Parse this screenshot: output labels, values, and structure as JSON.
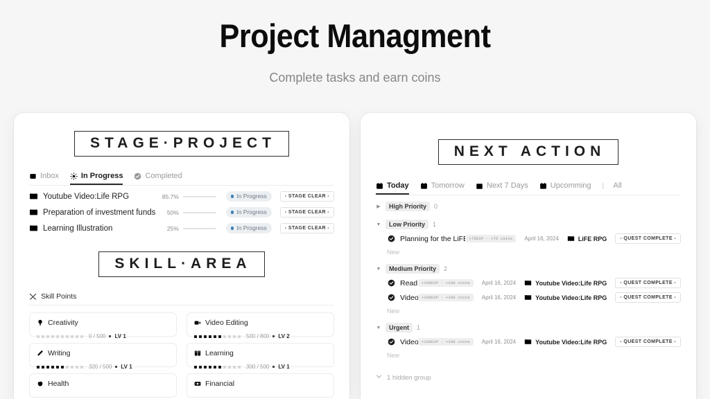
{
  "hero": {
    "title": "Project Managment",
    "subtitle": "Complete tasks and earn coins"
  },
  "colors": {
    "page_background": "#f6f6f6",
    "panel_background": "#ffffff",
    "text_primary": "#121212",
    "text_muted": "#9a9a9a",
    "status_dot_blue": "#3c7fbd",
    "chip_background": "#ededed"
  },
  "left_panel": {
    "heading": "STAGE·PROJECT",
    "tabs": [
      {
        "label": "Inbox",
        "icon": "inbox-icon",
        "active": false
      },
      {
        "label": "In Progress",
        "icon": "sun-icon",
        "active": true
      },
      {
        "label": "Completed",
        "icon": "check-circle-icon",
        "active": false
      }
    ],
    "projects": [
      {
        "icon": "folder-icon",
        "name": "Youtube Video:Life RPG",
        "percent_label": "85.7%",
        "percent_value": 85.7,
        "status": "In Progress",
        "action_label": "- STAGE CLEAR -"
      },
      {
        "icon": "folder-icon",
        "name": "Preparation of investment funds",
        "percent_label": "50%",
        "percent_value": 50,
        "status": "In Progress",
        "action_label": "- STAGE CLEAR -"
      },
      {
        "icon": "folder-icon",
        "name": "Learning Illustration",
        "percent_label": "25%",
        "percent_value": 25,
        "status": "In Progress",
        "action_label": "- STAGE CLEAR -"
      }
    ],
    "skill_heading": "SKILL·AREA",
    "skill_points_label": "Skill Points",
    "skill_points_icon": "crossed-swords-icon",
    "skills": [
      {
        "name": "Creativity",
        "icon": "lightbulb-icon",
        "pips_total": 10,
        "pips_filled": 0,
        "values": "0 / 500",
        "level": "LV 1"
      },
      {
        "name": "Video Editing",
        "icon": "video-icon",
        "pips_total": 10,
        "pips_filled": 6,
        "values": "500 / 800",
        "level": "LV 2"
      },
      {
        "name": "Writing",
        "icon": "pencil-icon",
        "pips_total": 10,
        "pips_filled": 6,
        "values": "320 / 500",
        "level": "LV 1"
      },
      {
        "name": "Learning",
        "icon": "book-icon",
        "pips_total": 10,
        "pips_filled": 6,
        "values": "300 / 500",
        "level": "LV 1"
      },
      {
        "name": "Health",
        "icon": "apple-icon",
        "pips_total": 10,
        "pips_filled": 0,
        "values": "",
        "level": ""
      },
      {
        "name": "Financial",
        "icon": "money-icon",
        "pips_total": 10,
        "pips_filled": 0,
        "values": "",
        "level": ""
      }
    ]
  },
  "right_panel": {
    "heading": "NEXT ACTION",
    "tabs": [
      {
        "label": "Today",
        "icon": "calendar-icon",
        "active": true
      },
      {
        "label": "Tomorrow",
        "icon": "calendar-icon",
        "active": false
      },
      {
        "label": "Next 7 Days",
        "icon": "calendar-grid-icon",
        "active": false
      },
      {
        "label": "Upcomming",
        "icon": "calendar-icon",
        "active": false
      },
      {
        "label": "All",
        "icon": "list-icon",
        "active": false
      }
    ],
    "groups": [
      {
        "label": "High Priority",
        "count": "0",
        "expanded": false,
        "tasks": [],
        "new_label": ""
      },
      {
        "label": "Low Priority",
        "count": "1",
        "expanded": true,
        "new_label": "New",
        "tasks": [
          {
            "name": "Planning for the LiFE RPG launch",
            "reward": "+75EXP · +75 coins",
            "date": "April 16, 2024",
            "project": "LiFE RPG",
            "action_label": "- QUEST COMPLETE -"
          }
        ]
      },
      {
        "label": "Medium Priority",
        "count": "2",
        "expanded": true,
        "new_label": "New",
        "tasks": [
          {
            "name": "Read Actionable Gamification",
            "reward": "+100EXP · +100 coins",
            "date": "April 16, 2024",
            "project": "Youtube Video:Life RPG",
            "action_label": "- QUEST COMPLETE -"
          },
          {
            "name": "Video Script",
            "reward": "+100EXP · +100 coins",
            "date": "April 16, 2024",
            "project": "Youtube Video:Life RPG",
            "action_label": "- QUEST COMPLETE -"
          }
        ]
      },
      {
        "label": "Urgent",
        "count": "1",
        "expanded": true,
        "new_label": "New",
        "tasks": [
          {
            "name": "Video Editing",
            "reward": "+100EXP · +100 coins",
            "date": "April 16, 2024",
            "project": "Youtube Video:Life RPG",
            "action_label": "- QUEST COMPLETE -"
          }
        ]
      }
    ],
    "hidden_group_label": "1 hidden group"
  }
}
